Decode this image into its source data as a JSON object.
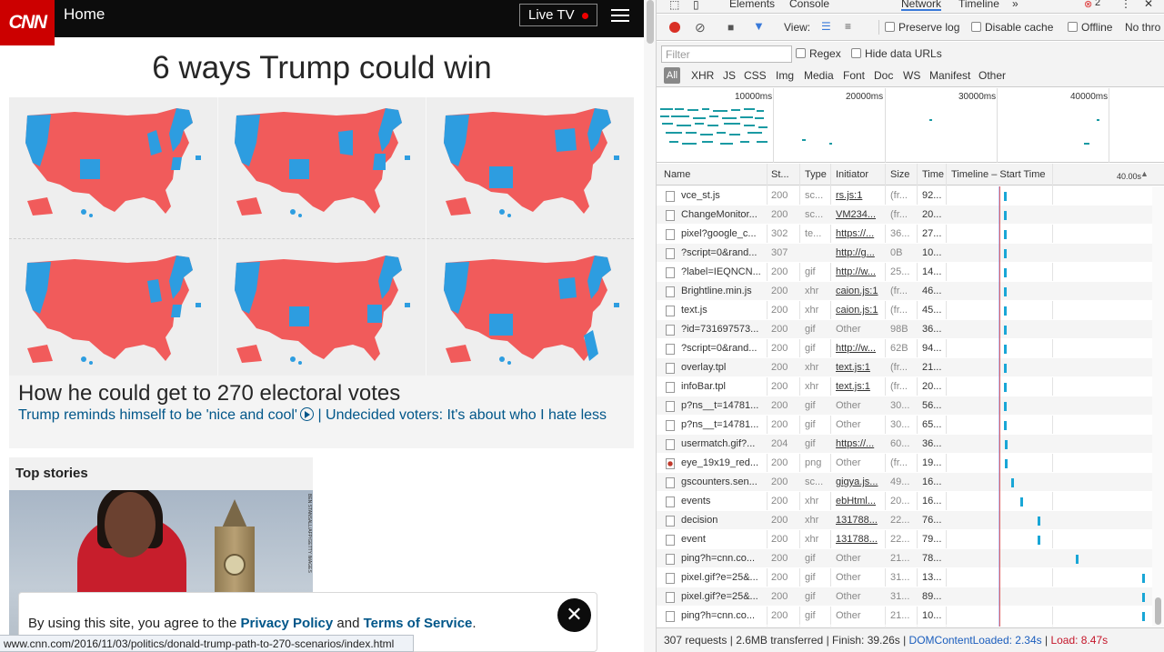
{
  "cnn": {
    "logo": "CNN",
    "section": "Home",
    "live_tv": "Live TV",
    "headline": "6 ways Trump could win",
    "subheadline": "How he could get to 270 electoral votes",
    "link1": "Trump reminds himself to be 'nice and cool'",
    "link_sep": "|",
    "link2": "Undecided voters: It's about who I hate less",
    "top_stories": "Top stories",
    "photo_credit": "BEN STANSALL/AFP/GETTY IMAGES",
    "consent_prefix": "By using this site, you agree to the",
    "privacy": "Privacy Policy",
    "and": "and",
    "terms": "Terms of Service",
    "period": ".",
    "close": "✕",
    "status_url": "www.cnn.com/2016/11/03/politics/donald-trump-path-to-270-scenarios/index.html",
    "colors": {
      "red": "#f15b5b",
      "blue": "#2d9de0",
      "brand": "#cc0000"
    }
  },
  "devtools": {
    "tabs": [
      "Elements",
      "Console",
      "Network",
      "Timeline",
      "»"
    ],
    "active_tab": "Network",
    "error_count": "2",
    "view_label": "View:",
    "preserve_log": "Preserve log",
    "disable_cache": "Disable cache",
    "offline": "Offline",
    "throttle": "No thro",
    "filter_placeholder": "Filter",
    "regex": "Regex",
    "hide_data_urls": "Hide data URLs",
    "types": [
      "All",
      "XHR",
      "JS",
      "CSS",
      "Img",
      "Media",
      "Font",
      "Doc",
      "WS",
      "Manifest",
      "Other"
    ],
    "overview_ticks": [
      "10000ms",
      "20000ms",
      "30000ms",
      "40000ms"
    ],
    "columns": [
      "Name",
      "St...",
      "Type",
      "Initiator",
      "Size",
      "Time",
      "Timeline – Start Time",
      "40.00s"
    ],
    "requests": [
      {
        "name": "vce_st.js",
        "status": "200",
        "type": "sc...",
        "initiator": "rs.js:1",
        "size": "(fr...",
        "time": "92...",
        "link": true
      },
      {
        "name": "ChangeMonitor...",
        "status": "200",
        "type": "sc...",
        "initiator": "VM234...",
        "size": "(fr...",
        "time": "20...",
        "link": true
      },
      {
        "name": "pixel?google_c...",
        "status": "302",
        "type": "te...",
        "initiator": "https://...",
        "size": "36...",
        "time": "27...",
        "link": true
      },
      {
        "name": "?script=0&rand...",
        "status": "307",
        "type": "",
        "initiator": "http://g...",
        "size": "0B",
        "time": "10...",
        "link": true
      },
      {
        "name": "?label=IEQNCN...",
        "status": "200",
        "type": "gif",
        "initiator": "http://w...",
        "size": "25...",
        "time": "14...",
        "link": true
      },
      {
        "name": "Brightline.min.js",
        "status": "200",
        "type": "xhr",
        "initiator": "caion.js:1",
        "size": "(fr...",
        "time": "46...",
        "link": true
      },
      {
        "name": "text.js",
        "status": "200",
        "type": "xhr",
        "initiator": "caion.js:1",
        "size": "(fr...",
        "time": "45...",
        "link": true
      },
      {
        "name": "?id=731697573...",
        "status": "200",
        "type": "gif",
        "initiator": "Other",
        "size": "98B",
        "time": "36...",
        "link": false
      },
      {
        "name": "?script=0&rand...",
        "status": "200",
        "type": "gif",
        "initiator": "http://w...",
        "size": "62B",
        "time": "94...",
        "link": true
      },
      {
        "name": "overlay.tpl",
        "status": "200",
        "type": "xhr",
        "initiator": "text.js:1",
        "size": "(fr...",
        "time": "21...",
        "link": true
      },
      {
        "name": "infoBar.tpl",
        "status": "200",
        "type": "xhr",
        "initiator": "text.js:1",
        "size": "(fr...",
        "time": "20...",
        "link": true
      },
      {
        "name": "p?ns__t=14781...",
        "status": "200",
        "type": "gif",
        "initiator": "Other",
        "size": "30...",
        "time": "56...",
        "link": false
      },
      {
        "name": "p?ns__t=14781...",
        "status": "200",
        "type": "gif",
        "initiator": "Other",
        "size": "30...",
        "time": "65...",
        "link": false
      },
      {
        "name": "usermatch.gif?...",
        "status": "204",
        "type": "gif",
        "initiator": "https://...",
        "size": "60...",
        "time": "36...",
        "link": true
      },
      {
        "name": "eye_19x19_red...",
        "status": "200",
        "type": "png",
        "initiator": "Other",
        "size": "(fr...",
        "time": "19...",
        "link": false
      },
      {
        "name": "gscounters.sen...",
        "status": "200",
        "type": "sc...",
        "initiator": "gigya.js...",
        "size": "49...",
        "time": "16...",
        "link": true
      },
      {
        "name": "events",
        "status": "200",
        "type": "xhr",
        "initiator": "ebHtml...",
        "size": "20...",
        "time": "16...",
        "link": true
      },
      {
        "name": "decision",
        "status": "200",
        "type": "xhr",
        "initiator": "131788...",
        "size": "22...",
        "time": "76...",
        "link": true
      },
      {
        "name": "event",
        "status": "200",
        "type": "xhr",
        "initiator": "131788...",
        "size": "22...",
        "time": "79...",
        "link": true
      },
      {
        "name": "ping?h=cnn.co...",
        "status": "200",
        "type": "gif",
        "initiator": "Other",
        "size": "21...",
        "time": "78...",
        "link": false
      },
      {
        "name": "pixel.gif?e=25&...",
        "status": "200",
        "type": "gif",
        "initiator": "Other",
        "size": "31...",
        "time": "13...",
        "link": false
      },
      {
        "name": "pixel.gif?e=25&...",
        "status": "200",
        "type": "gif",
        "initiator": "Other",
        "size": "31...",
        "time": "89...",
        "link": false
      },
      {
        "name": "ping?h=cnn.co...",
        "status": "200",
        "type": "gif",
        "initiator": "Other",
        "size": "21...",
        "time": "10...",
        "link": false
      }
    ],
    "status": {
      "requests": "307 requests",
      "sep1": " | ",
      "transferred": "2.6MB transferred",
      "sep2": " | ",
      "finish": "Finish: 39.26s",
      "sep3": " | ",
      "dcl": "DOMContentLoaded: 2.34s",
      "sep4": " | ",
      "load": "Load: 8.47s"
    }
  }
}
